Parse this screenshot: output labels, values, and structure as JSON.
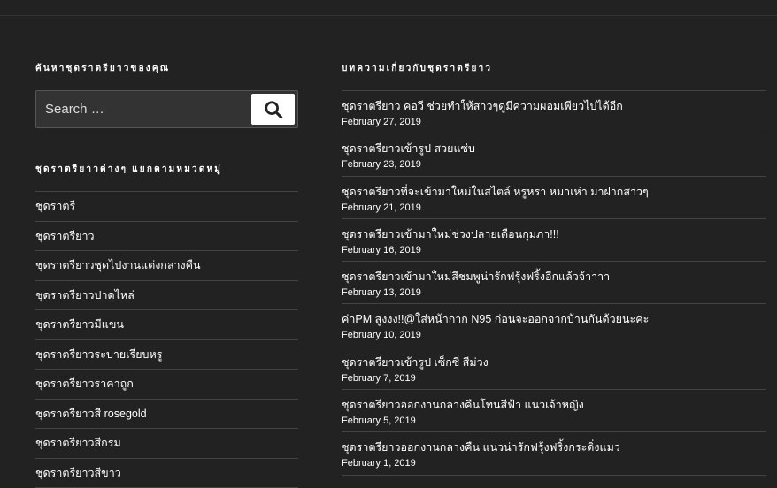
{
  "search_widget": {
    "title": "ค้นหาชุดราตรียาวของคุณ",
    "placeholder": "Search …"
  },
  "categories_widget": {
    "title": "ชุดราตรียาวต่างๆ แยกตามหมวดหมู่",
    "items": [
      "ชุดราตรี",
      "ชุดราตรียาว",
      "ชุดราตรียาวชุดไปงานแต่งกลางคืน",
      "ชุดราตรียาวปาดไหล่",
      "ชุดราตรียาวมีแขน",
      "ชุดราตรียาวระบายเรียบหรู",
      "ชุดราตรียาวราคาถูก",
      "ชุดราตรียาวสี rosegold",
      "ชุดราตรียาวสีกรม",
      "ชุดราตรียาวสีขาว"
    ]
  },
  "posts_widget": {
    "title": "บทความเกี่ยวกับชุดราตรียาว",
    "posts": [
      {
        "title": "ชุดราตรียาว คอวี ช่วยทำให้สาวๆดูมีความผอมเพียวไปได้อีก",
        "date": "February 27, 2019"
      },
      {
        "title": "ชุดราตรียาวเข้ารูป สวยแซ่บ",
        "date": "February 23, 2019"
      },
      {
        "title": "ชุดราตรียาวที่จะเข้ามาใหม่ในสไตล์ หรูหรา หมาเห่า มาฝากสาวๆ",
        "date": "February 21, 2019"
      },
      {
        "title": "ชุดราตรียาวเข้ามาใหม่ช่วงปลายเดือนกุมภา!!!",
        "date": "February 16, 2019"
      },
      {
        "title": "ชุดราตรียาวเข้ามาใหม่สีชมพูน่ารักฟรุ้งฟริ้งอีกแล้วจ้าาาา",
        "date": "February 13, 2019"
      },
      {
        "title": "ค่าPM สูงงง!!@ใส่หน้ากาก N95 ก่อนจะออกจากบ้านกันด้วยนะคะ",
        "date": "February 10, 2019"
      },
      {
        "title": "ชุดราตรียาวเข้ารูป เซ็กซี่ สีม่วง",
        "date": "February 7, 2019"
      },
      {
        "title": "ชุดราตรียาวออกงานกลางคืนโทนสีฟ้า แนวเจ้าหญิง",
        "date": "February 5, 2019"
      },
      {
        "title": "ชุดราตรียาวออกงานกลางคืน แนวน่ารักฟรุ้งฟริ้งกระดิ่งแมว",
        "date": "February 1, 2019"
      }
    ]
  }
}
